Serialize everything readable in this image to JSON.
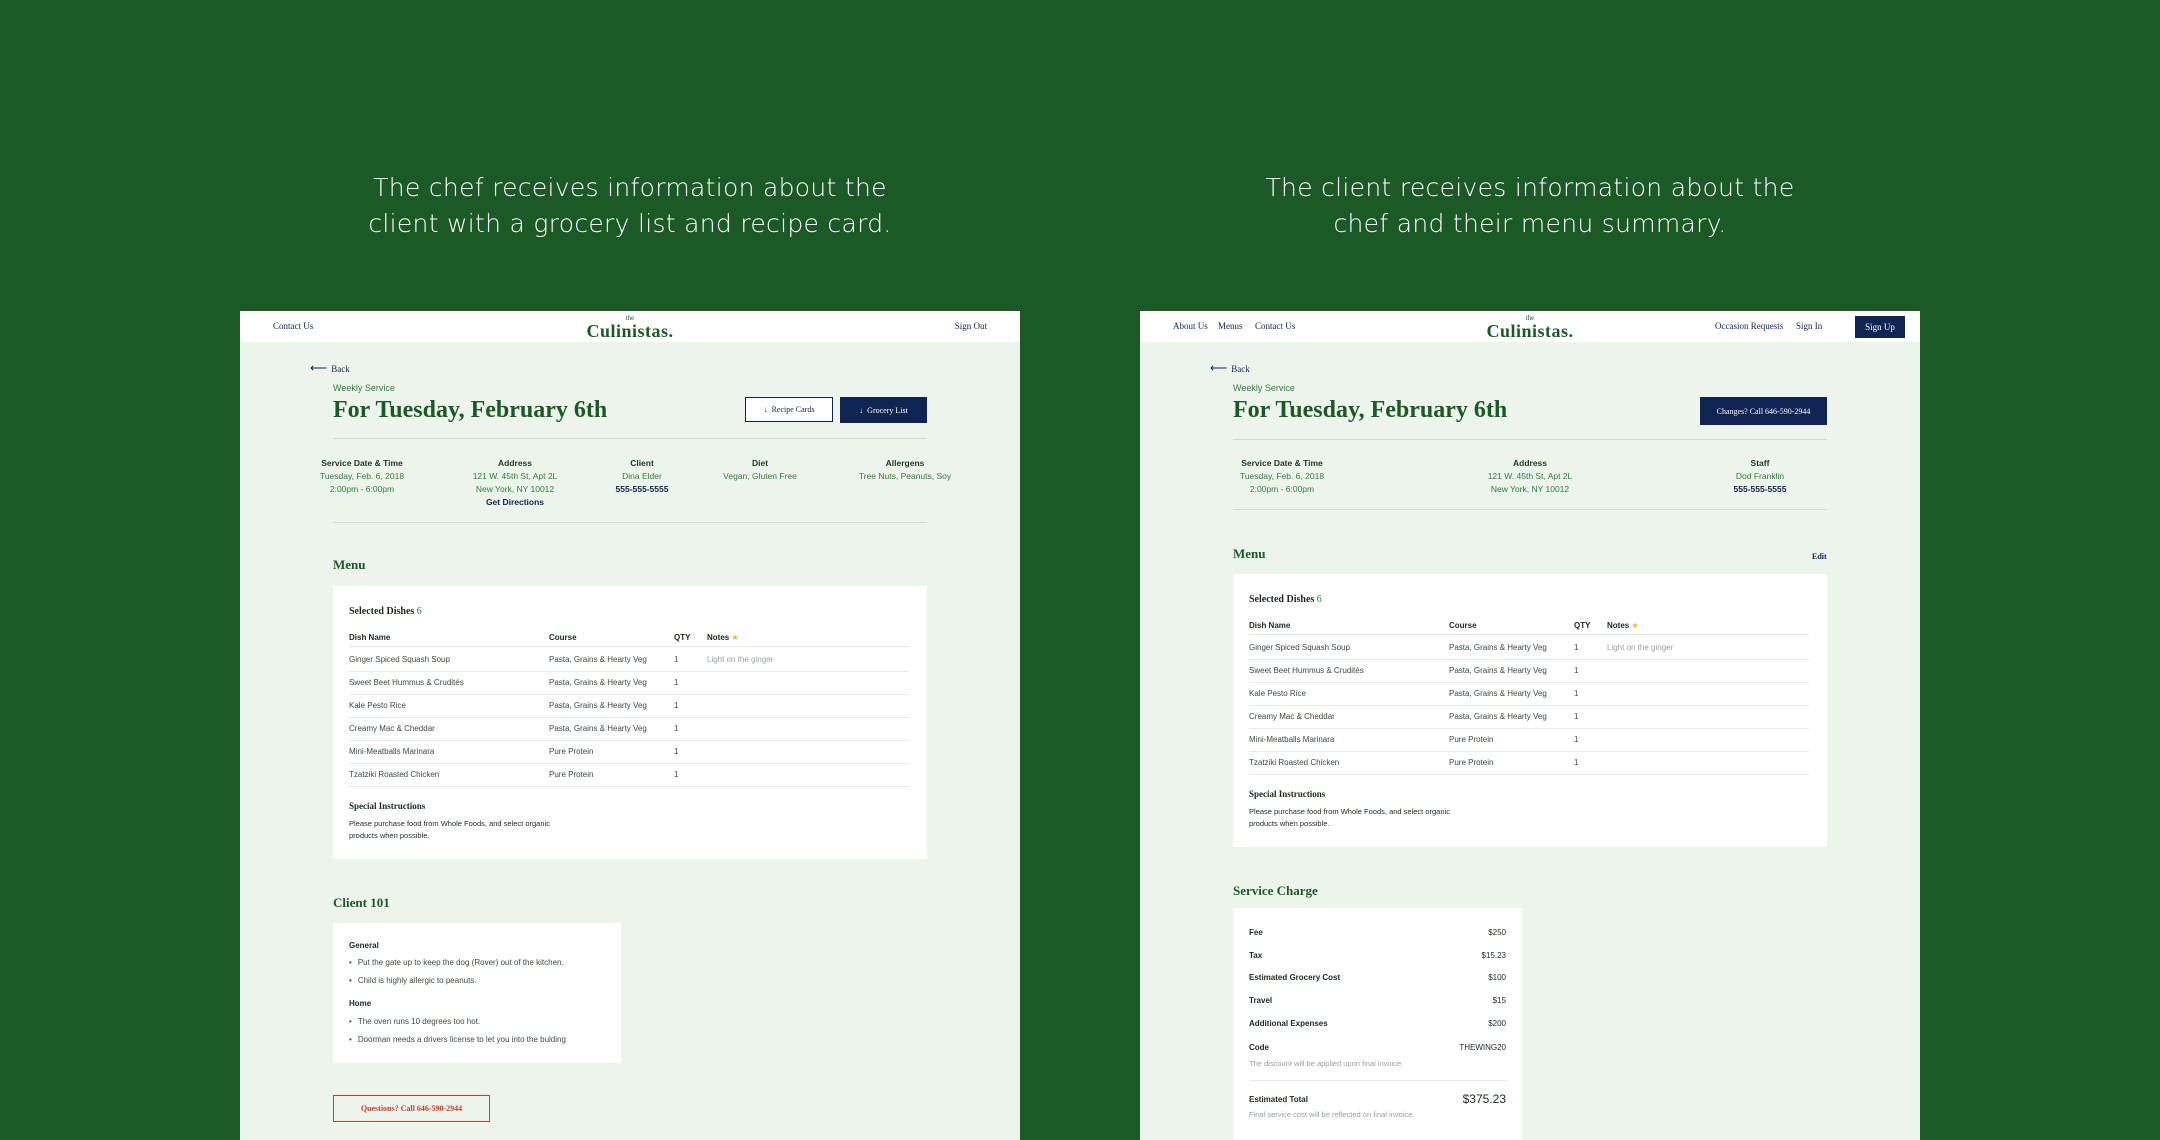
{
  "captions": {
    "left": "The chef receives information about the client with a grocery list and recipe card.",
    "right": "The client receives information about the chef and their menu summary."
  },
  "brand": {
    "the": "the",
    "name": "Culinistas."
  },
  "left": {
    "nav": {
      "contact": "Contact Us",
      "signout": "Sign Out"
    },
    "back": "Back",
    "eyebrow": "Weekly Service",
    "title": "For Tuesday, February 6th",
    "buttons": {
      "recipe_cards": "Recipe Cards",
      "grocery_list": "Grocery List"
    },
    "info": {
      "service": {
        "label": "Service Date & Time",
        "line1": "Tuesday, Feb. 6, 2018",
        "line2": "2:00pm - 6:00pm"
      },
      "address": {
        "label": "Address",
        "line1": "121 W. 45th St, Apt 2L",
        "line2": "New York, NY 10012",
        "link": "Get Directions"
      },
      "client": {
        "label": "Client",
        "line1": "Dina Elder",
        "phone": "555-555-5555"
      },
      "diet": {
        "label": "Diet",
        "line1": "Vegan, Gluten Free"
      },
      "allergens": {
        "label": "Allergens",
        "line1": "Tree Nuts, Peanuts, Soy"
      }
    },
    "menu_title": "Menu",
    "client101": {
      "title": "Client 101",
      "general_label": "General",
      "general": [
        "Put the gate up to keep the dog (Rover) out of the kitchen.",
        "Child is highly allergic to peanuts."
      ],
      "home_label": "Home",
      "home": [
        "The oven runs 10 degrees too hot.",
        "Doorman needs a drivers license to let you into the bulding"
      ]
    },
    "questions_button": "Questions? Call 646-590-2944"
  },
  "right": {
    "nav": {
      "about": "About Us",
      "menus": "Menus",
      "contact": "Contact Us",
      "occasion": "Occasion Requests",
      "signin": "Sign In",
      "signup": "Sign Up"
    },
    "back": "Back",
    "eyebrow": "Weekly Service",
    "title": "For Tuesday, February 6th",
    "changes_button": "Changes? Call 646-590-2944",
    "info": {
      "service": {
        "label": "Service Date & Time",
        "line1": "Tuesday, Feb. 6, 2018",
        "line2": "2:00pm - 6:00pm"
      },
      "address": {
        "label": "Address",
        "line1": "121 W. 45th St, Apt 2L",
        "line2": "New York, NY 10012"
      },
      "staff": {
        "label": "Staff",
        "line1": "Dod Franklin",
        "phone": "555-555-5555"
      }
    },
    "menu_title": "Menu",
    "edit": "Edit",
    "service_charge": {
      "title": "Service Charge",
      "fee": {
        "label": "Fee",
        "value": "$250"
      },
      "tax": {
        "label": "Tax",
        "value": "$15.23"
      },
      "grocery": {
        "label": "Estimated Grocery Cost",
        "value": "$100"
      },
      "travel": {
        "label": "Travel",
        "value": "$15"
      },
      "additional": {
        "label": "Additional Expenses",
        "value": "$200"
      },
      "code": {
        "label": "Code",
        "value": "THEWING20",
        "note": "The discount will be applied upon final invoice."
      },
      "total": {
        "label": "Estimated Total",
        "value": "$375.23",
        "note": "Final service cost will be reflected on final invoice."
      }
    }
  },
  "menu": {
    "selected_label": "Selected Dishes",
    "count": "6",
    "headers": {
      "dish": "Dish Name",
      "course": "Course",
      "qty": "QTY",
      "notes": "Notes"
    },
    "star": "★",
    "rows": [
      {
        "dish": "Ginger Spiced Squash Soup",
        "course": "Pasta, Grains & Hearty Veg",
        "qty": "1",
        "notes": "Light on the ginger"
      },
      {
        "dish": "Sweet Beet Hummus & Crudités",
        "course": "Pasta, Grains & Hearty Veg",
        "qty": "1",
        "notes": ""
      },
      {
        "dish": "Kale Pesto Rice",
        "course": "Pasta, Grains & Hearty Veg",
        "qty": "1",
        "notes": ""
      },
      {
        "dish": "Creamy Mac & Cheddar",
        "course": "Pasta, Grains & Hearty Veg",
        "qty": "1",
        "notes": ""
      },
      {
        "dish": "Mini-Meatballs Marinara",
        "course": "Pure Protein",
        "qty": "1",
        "notes": ""
      },
      {
        "dish": "Tzatziki Roasted Chicken",
        "course": "Pure Protein",
        "qty": "1",
        "notes": ""
      }
    ],
    "special_title": "Special Instructions",
    "special_text": "Please purchase food from Whole Foods, and select organic products when possible."
  }
}
